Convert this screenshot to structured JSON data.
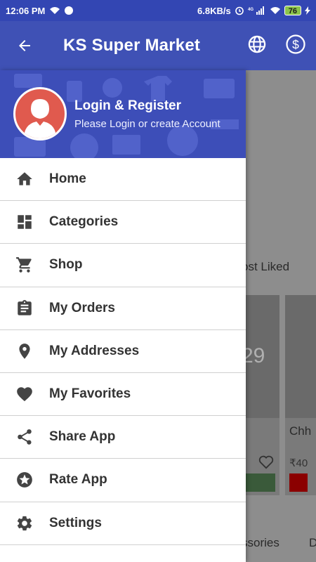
{
  "status_bar": {
    "time": "12:06 PM",
    "speed": "6.8KB/s",
    "battery": "76"
  },
  "app_bar": {
    "title": "KS Super Market",
    "icons": [
      "arrow-back-icon",
      "globe-icon",
      "currency-icon"
    ]
  },
  "drawer": {
    "header": {
      "title": "Login & Register",
      "subtitle": "Please Login or create Account"
    },
    "items": [
      {
        "label": "Home",
        "icon": "home-icon"
      },
      {
        "label": "Categories",
        "icon": "dashboard-icon"
      },
      {
        "label": "Shop",
        "icon": "cart-icon"
      },
      {
        "label": "My Orders",
        "icon": "clipboard-icon"
      },
      {
        "label": "My Addresses",
        "icon": "location-pin-icon"
      },
      {
        "label": "My Favorites",
        "icon": "heart-icon"
      },
      {
        "label": "Share App",
        "icon": "share-icon"
      },
      {
        "label": "Rate App",
        "icon": "star-circle-icon"
      },
      {
        "label": "Settings",
        "icon": "gear-icon"
      }
    ]
  },
  "background": {
    "section_label": "ost Liked",
    "price_fragment": "29",
    "product_fragment": "Chh",
    "price": "₹40",
    "tab_fragment": "ssories",
    "tab_fragment_2": "D"
  },
  "colors": {
    "primary": "#3f51b5",
    "status": "#3346b3",
    "avatar": "#e05a4e"
  }
}
